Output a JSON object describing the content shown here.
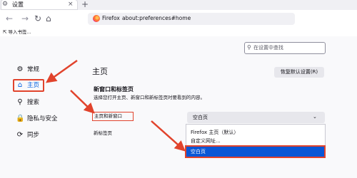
{
  "tab": {
    "title": "设置",
    "icon": "gear-icon"
  },
  "toolbar": {
    "back_icon": "back-arrow-icon",
    "forward_icon": "forward-arrow-icon",
    "reload_icon": "reload-icon",
    "browser_label": "Firefox",
    "url": "about:preferences#home"
  },
  "bookmarks": {
    "import_label": "导入书签..."
  },
  "search": {
    "placeholder": "在设置中查找"
  },
  "sidebar": {
    "items": [
      {
        "label": "常规",
        "icon": "gear-icon",
        "glyph": "⚙"
      },
      {
        "label": "主页",
        "icon": "home-icon",
        "glyph": "⌂"
      },
      {
        "label": "搜索",
        "icon": "search-icon",
        "glyph": "⚲"
      },
      {
        "label": "隐私与安全",
        "icon": "lock-icon",
        "glyph": "🔒"
      },
      {
        "label": "同步",
        "icon": "sync-icon",
        "glyph": "⟳"
      }
    ]
  },
  "main": {
    "title": "主页",
    "restore_button": "恢复默认设置(R)",
    "section_title": "新窗口和标签页",
    "section_desc": "选择您打开主页、新窗口和新标签页时要看到的内容。",
    "home_label": "主页和新窗口",
    "newtab_label": "新标签页",
    "select_value": "空白页",
    "options": [
      "Firefox 主页（默认）",
      "自定义网址...",
      "空白页"
    ]
  },
  "colors": {
    "accent": "#0061e0",
    "highlight": "#e1432c",
    "selected": "#0a57d6"
  }
}
